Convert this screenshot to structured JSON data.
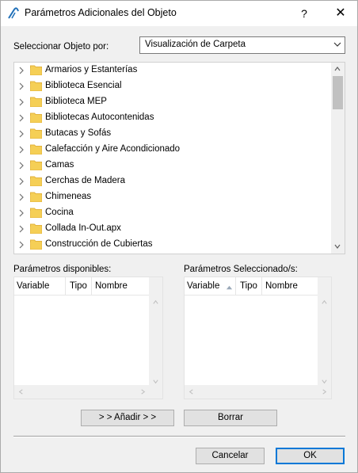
{
  "window": {
    "title": "Parámetros Adicionales del Objeto",
    "help_label": "?",
    "close_label": "✕"
  },
  "selector": {
    "label": "Seleccionar Objeto por:",
    "value": "Visualización de Carpeta"
  },
  "folders": [
    "Armarios y Estanterías",
    "Biblioteca Esencial",
    "Biblioteca MEP",
    "Bibliotecas Autocontenidas",
    "Butacas y Sofás",
    "Calefacción y Aire Acondicionado",
    "Camas",
    "Cerchas de Madera",
    "Chimeneas",
    "Cocina",
    "Collada In-Out.apx",
    "Construcción de Cubiertas"
  ],
  "available": {
    "label": "Parámetros disponibles:",
    "columns": [
      "Variable",
      "Tipo",
      "Nombre"
    ]
  },
  "selected": {
    "label": "Parámetros Seleccionado/s:",
    "columns": [
      "Variable",
      "Tipo",
      "Nombre"
    ]
  },
  "buttons": {
    "add": "> > Añadir > >",
    "remove": "Borrar",
    "cancel": "Cancelar",
    "ok": "OK"
  },
  "colors": {
    "accent": "#0078d7",
    "folder": "#f5cf56",
    "folder_dark": "#e2b33c"
  }
}
